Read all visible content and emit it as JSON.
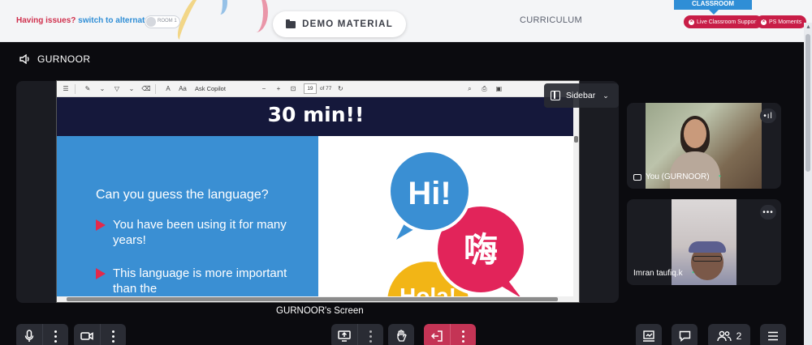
{
  "topbar": {
    "issues_prefix": "Having issues?",
    "issues_link": "switch to alternate room",
    "room_toggle_label": "ROOM 1",
    "demo_material_label": "DEMO MATERIAL",
    "curriculum_label": "CURRICULUM",
    "classroom_tab_label": "CLASSROOM",
    "live_support_label": "Live Classroom Support",
    "ps_moments_label": "PS Moments"
  },
  "session": {
    "presenter_name": "GURNOOR",
    "screen_label": "GURNOOR's Screen"
  },
  "sidebar_chip": {
    "label": "Sidebar"
  },
  "pdf": {
    "ask_copilot_label": "Ask Copilot",
    "current_page": "19",
    "total_pages": "of 77",
    "zoom_text_icon": "A",
    "read_aloud_icon": "Aa"
  },
  "slide": {
    "title": "30 min!!",
    "question": "Can you guess the language?",
    "bullet_1": "You have been using it for many years!",
    "bullet_2": "This language is more important than the",
    "bubble_1": "Hi!",
    "bubble_2": "嗨",
    "bubble_3": "Hola!"
  },
  "participants": [
    {
      "name": "You (GURNOOR)"
    },
    {
      "name": "Imran taufiq.k"
    }
  ],
  "controls": {
    "participant_count": "2"
  },
  "colors": {
    "brand_red": "#c81d47",
    "brand_blue": "#2f8ed6",
    "slide_blue": "#3a8fd3",
    "slide_navy": "#15183b",
    "leave_red": "#c43455"
  },
  "icons": [
    "speaker-icon",
    "folder-icon",
    "sidebar-icon",
    "mic-icon",
    "camera-icon",
    "share-screen-icon",
    "raise-hand-icon",
    "leave-icon",
    "whiteboard-icon",
    "chat-icon",
    "participants-icon",
    "menu-icon",
    "wifi-icon",
    "more-icon"
  ]
}
